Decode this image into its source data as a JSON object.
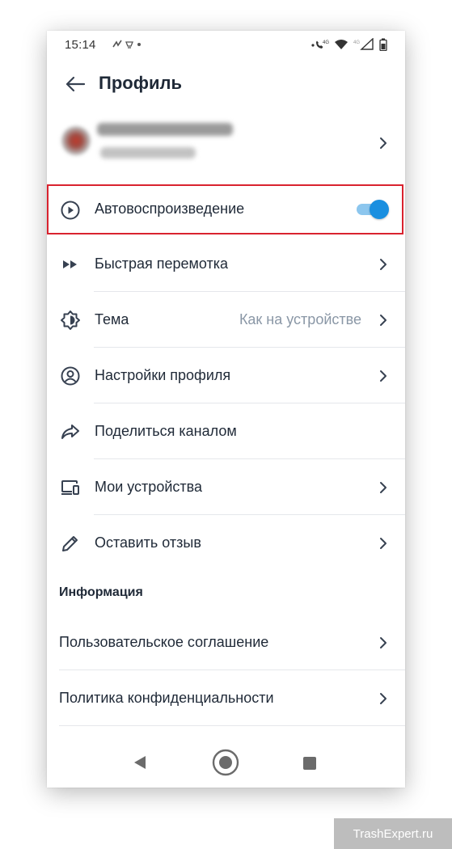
{
  "status_bar": {
    "time": "15:14",
    "network_label_1": "4G",
    "network_label_2": "4G"
  },
  "header": {
    "title": "Профиль"
  },
  "settings": {
    "autoplay": {
      "label": "Автовоспроизведение",
      "enabled": true
    },
    "items": [
      {
        "label": "Быстрая перемотка",
        "value": ""
      },
      {
        "label": "Тема",
        "value": "Как на устройстве"
      },
      {
        "label": "Настройки профиля",
        "value": ""
      },
      {
        "label": "Поделиться каналом",
        "value": ""
      },
      {
        "label": "Мои устройства",
        "value": ""
      },
      {
        "label": "Оставить отзыв",
        "value": ""
      }
    ]
  },
  "info": {
    "section_title": "Информация",
    "items": [
      {
        "label": "Пользовательское соглашение"
      },
      {
        "label": "Политика конфиденциальности"
      }
    ]
  },
  "icons": {
    "back": "arrow-left-icon",
    "autoplay": "play-circle-icon",
    "fast_forward": "fast-forward-icon",
    "theme": "theme-brightness-icon",
    "profile_settings": "user-circle-icon",
    "share": "share-arrow-icon",
    "devices": "devices-icon",
    "feedback": "pencil-icon"
  },
  "colors": {
    "highlight_border": "#d9232f",
    "toggle_on": "#1a8fe0",
    "secondary_text": "#8a97a6"
  },
  "watermark": "TrashExpert.ru"
}
